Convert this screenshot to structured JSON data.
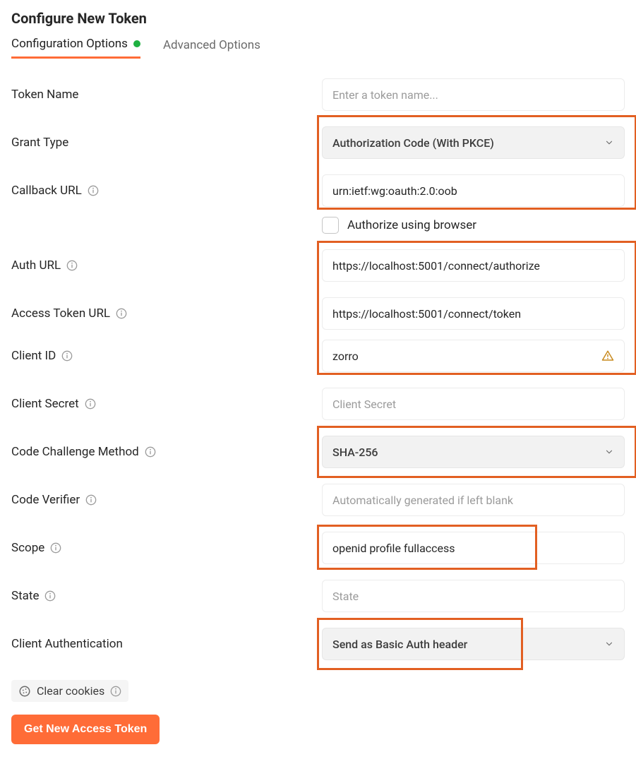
{
  "title": "Configure New Token",
  "tabs": {
    "config": "Configuration Options",
    "advanced": "Advanced Options"
  },
  "fields": {
    "token_name": {
      "label": "Token Name",
      "placeholder": "Enter a token name...",
      "value": ""
    },
    "grant_type": {
      "label": "Grant Type",
      "value": "Authorization Code (With PKCE)"
    },
    "callback_url": {
      "label": "Callback URL",
      "value": "urn:ietf:wg:oauth:2.0:oob"
    },
    "authorize_browser": {
      "label": "Authorize using browser",
      "checked": false
    },
    "auth_url": {
      "label": "Auth URL",
      "value": "https://localhost:5001/connect/authorize"
    },
    "access_token_url": {
      "label": "Access Token URL",
      "value": "https://localhost:5001/connect/token"
    },
    "client_id": {
      "label": "Client ID",
      "value": "zorro"
    },
    "client_secret": {
      "label": "Client Secret",
      "placeholder": "Client Secret",
      "value": ""
    },
    "code_challenge_method": {
      "label": "Code Challenge Method",
      "value": "SHA-256"
    },
    "code_verifier": {
      "label": "Code Verifier",
      "placeholder": "Automatically generated if left blank",
      "value": ""
    },
    "scope": {
      "label": "Scope",
      "value": "openid profile fullaccess"
    },
    "state": {
      "label": "State",
      "placeholder": "State",
      "value": ""
    },
    "client_auth": {
      "label": "Client Authentication",
      "value": "Send as Basic Auth header"
    }
  },
  "actions": {
    "clear_cookies": "Clear cookies",
    "get_token": "Get New Access Token"
  }
}
